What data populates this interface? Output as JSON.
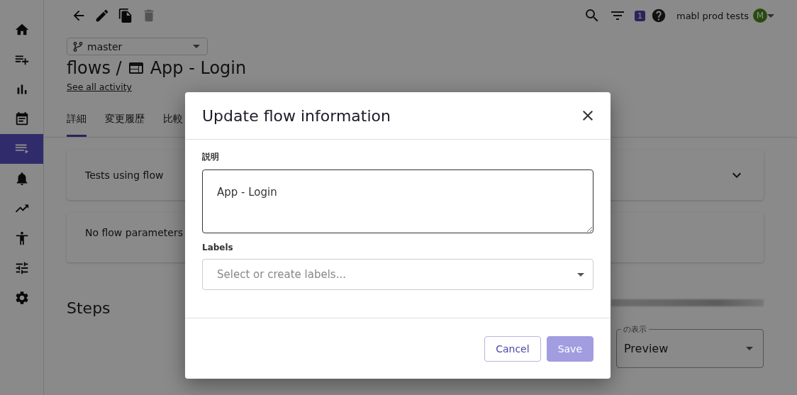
{
  "sidebar": {
    "items": [
      {
        "kind": "home",
        "selected": false
      },
      {
        "kind": "add-list",
        "selected": false
      },
      {
        "kind": "chart",
        "selected": false
      },
      {
        "kind": "calendar",
        "selected": false
      },
      {
        "kind": "play-list",
        "selected": true
      },
      {
        "kind": "bell",
        "selected": false
      },
      {
        "kind": "trend",
        "selected": false
      },
      {
        "kind": "figure",
        "selected": false
      },
      {
        "kind": "sliders",
        "selected": false
      },
      {
        "kind": "gear",
        "selected": false
      }
    ]
  },
  "toolbar": {
    "actions": [
      {
        "kind": "back",
        "disabled": false
      },
      {
        "kind": "edit",
        "disabled": false
      },
      {
        "kind": "copy",
        "disabled": false
      },
      {
        "kind": "delete",
        "disabled": true
      }
    ]
  },
  "header": {
    "badge": "1",
    "account": "mabl prod tests",
    "avatar": "M"
  },
  "branch": {
    "value": "master"
  },
  "title": {
    "prefix": "flows /",
    "name": "App - Login"
  },
  "activity_link": "See all activity",
  "tabs": [
    {
      "label": "詳細",
      "selected": true
    },
    {
      "label": "変更履歴",
      "selected": false
    },
    {
      "label": "比較",
      "selected": false
    }
  ],
  "cards": [
    {
      "text": "Tests using flow",
      "expandable": true
    },
    {
      "text": "No flow parameters",
      "expandable": false
    }
  ],
  "steps": {
    "title": "Steps",
    "view_select": {
      "label": "の表示",
      "value": "Preview"
    }
  },
  "dialog": {
    "title": "Update flow information",
    "description": {
      "label": "説明",
      "value": "App - Login"
    },
    "labels": {
      "label": "Labels",
      "placeholder": "Select or create labels..."
    },
    "buttons": [
      {
        "label": "Cancel",
        "kind": "secondary",
        "disabled": false
      },
      {
        "label": "Save",
        "kind": "primary",
        "disabled": true
      }
    ]
  }
}
